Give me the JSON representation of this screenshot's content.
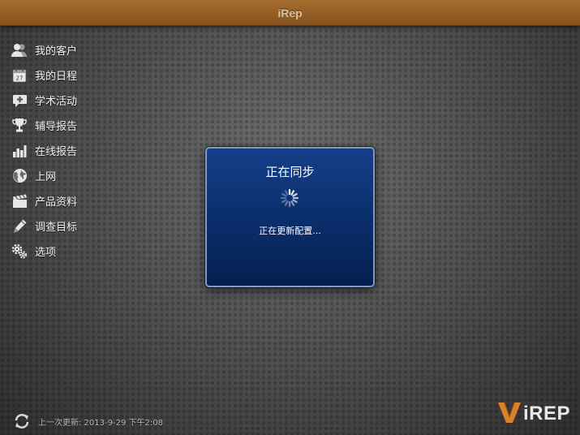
{
  "app": {
    "title": "iRep"
  },
  "sidebar": {
    "items": [
      {
        "label": "我的客户",
        "icon": "customers-icon"
      },
      {
        "label": "我的日程",
        "icon": "calendar-icon"
      },
      {
        "label": "学术活动",
        "icon": "activity-icon"
      },
      {
        "label": "辅导报告",
        "icon": "trophy-icon"
      },
      {
        "label": "在线报告",
        "icon": "bar-chart-icon"
      },
      {
        "label": "上网",
        "icon": "globe-icon"
      },
      {
        "label": "产品资料",
        "icon": "clapper-icon"
      },
      {
        "label": "调查目标",
        "icon": "pencil-icon"
      },
      {
        "label": "选项",
        "icon": "gears-icon"
      }
    ],
    "calendar_day": "27"
  },
  "sync_dialog": {
    "title": "正在同步",
    "message": "正在更新配置..."
  },
  "footer": {
    "last_update": "上一次更新: 2013-9-29 下午2:08"
  },
  "brand": {
    "logo_text": "iREP",
    "accent": "#a46c2e",
    "dialog_blue": "#0b2f6c",
    "logo_orange": "#d9822b"
  }
}
